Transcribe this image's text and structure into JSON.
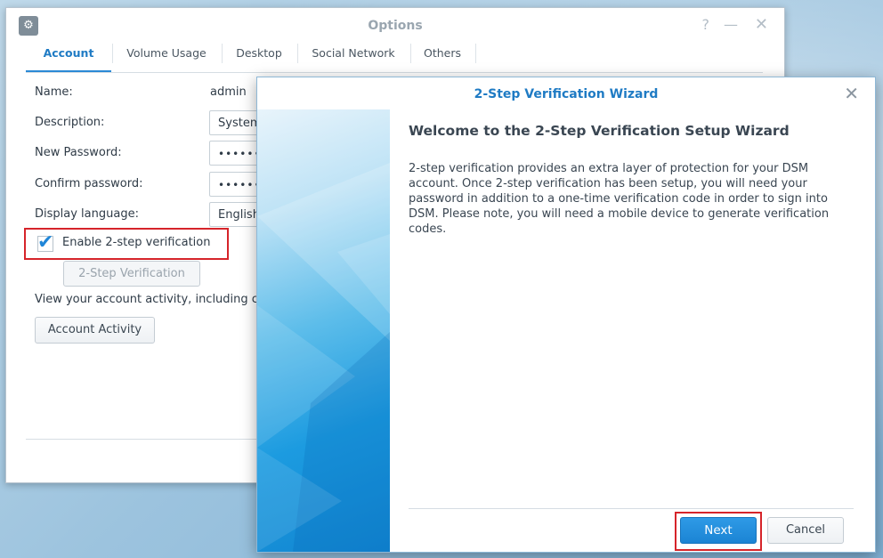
{
  "options_window": {
    "title": "Options",
    "help_icon": "?",
    "minimize_icon": "—",
    "close_icon": "✕",
    "tabs": [
      {
        "label": "Account",
        "active": true
      },
      {
        "label": "Volume Usage",
        "active": false
      },
      {
        "label": "Desktop",
        "active": false
      },
      {
        "label": "Social Network",
        "active": false
      },
      {
        "label": "Others",
        "active": false
      }
    ],
    "form": {
      "name_label": "Name:",
      "name_value": "admin",
      "description_label": "Description:",
      "description_value": "System",
      "new_password_label": "New Password:",
      "new_password_value": "••••••",
      "confirm_password_label": "Confirm password:",
      "confirm_password_value": "••••••",
      "display_language_label": "Display language:",
      "display_language_value": "English"
    },
    "enable_2step_label": "Enable 2-step verification",
    "enable_2step_checked": true,
    "two_step_button": "2-Step Verification",
    "activity_text": "View your account activity, including c",
    "account_activity_button": "Account Activity"
  },
  "wizard": {
    "title": "2-Step Verification Wizard",
    "close_icon": "✕",
    "heading": "Welcome to the 2-Step Verification Setup Wizard",
    "body": "2-step verification provides an extra layer of protection for your DSM account. Once 2-step verification has been setup, you will need your password in addition to a one-time verification code in order to sign into DSM. Please note, you will need a mobile device to generate verification codes.",
    "next_button": "Next",
    "cancel_button": "Cancel"
  },
  "colors": {
    "accent": "#1f7bc4",
    "highlight": "#d6242a",
    "primary_button": "#1b84d4"
  }
}
